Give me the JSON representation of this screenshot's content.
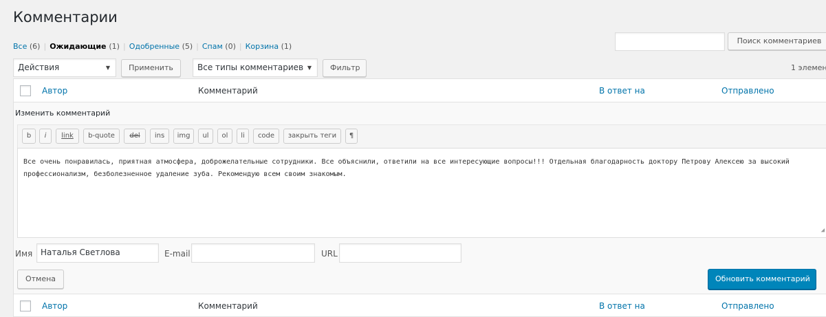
{
  "page": {
    "title": "Комментарии"
  },
  "filters": [
    {
      "label": "Все",
      "count": "(6)",
      "current": false
    },
    {
      "label": "Ожидающие",
      "count": "(1)",
      "current": true
    },
    {
      "label": "Одобренные",
      "count": "(5)",
      "current": false
    },
    {
      "label": "Спам",
      "count": "(0)",
      "current": false
    },
    {
      "label": "Корзина",
      "count": "(1)",
      "current": false
    }
  ],
  "search": {
    "value": "",
    "button_label": "Поиск комментариев"
  },
  "toolbar": {
    "bulk_action": "Действия",
    "apply_label": "Применить",
    "comment_type": "Все типы комментариев",
    "filter_label": "Фильтр",
    "items_count": "1 элемен"
  },
  "columns": {
    "author": "Автор",
    "comment": "Комментарий",
    "response": "В ответ на",
    "date": "Отправлено"
  },
  "editor": {
    "title": "Изменить комментарий",
    "quicktags": [
      "b",
      "i",
      "link",
      "b-quote",
      "del",
      "ins",
      "img",
      "ul",
      "ol",
      "li",
      "code",
      "закрыть теги",
      "¶"
    ],
    "content": "Все очень понравилась, приятная атмосфера, доброжелательные сотрудники. Все объяснили, ответили на все интересующие вопросы!!! Отдельная благодарность доктору Петрову Алексею за высокий профессионализм, безболезненное удаление зуба. Рекомендую всем своим знакомым.",
    "name_label": "Имя",
    "name_value": "Наталья Светлова",
    "email_label": "E-mail",
    "email_value": "",
    "url_label": "URL",
    "url_value": "",
    "cancel_label": "Отмена",
    "update_label": "Обновить комментарий"
  },
  "colors": {
    "link": "#0073aa",
    "primary_button": "#0085ba",
    "background": "#f1f1f1"
  }
}
